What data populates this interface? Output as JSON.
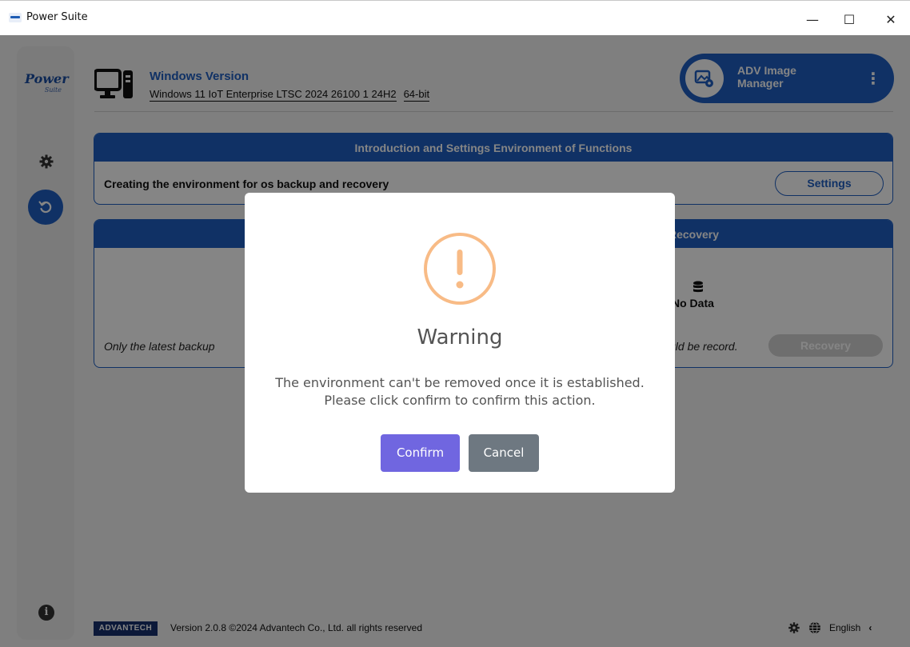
{
  "window": {
    "title": "Power Suite",
    "minimize": "—",
    "maximize": "☐",
    "close": "✕"
  },
  "sidebar": {
    "logo_main": "Power",
    "logo_sub": "Suite",
    "items": [
      {
        "icon": "gear-icon"
      },
      {
        "icon": "restore-icon",
        "active": true
      },
      {
        "icon": "info-icon"
      }
    ]
  },
  "header": {
    "os_title": "Windows Version",
    "os_name": "Windows 11 IoT Enterprise LTSC 2024 26100 1 24H2",
    "arch": "64-bit",
    "app_button": "ADV Image Manager"
  },
  "card_settings": {
    "title": "Introduction and Settings Environment of Functions",
    "description": "Creating the environment for os backup and recovery",
    "button": "Settings"
  },
  "card_recovery": {
    "title_visible": "Recovery",
    "no_data": "No Data",
    "note_left": "Only the latest backup",
    "note_right": "uld be record.",
    "button": "Recovery"
  },
  "footer": {
    "brand": "ADVANTECH",
    "version": "Version 2.0.8 ©2024 Advantech Co., Ltd. all rights reserved",
    "language": "English"
  },
  "dialog": {
    "title": "Warning",
    "message": "The environment can't be removed once it is established. Please click confirm to confirm this action.",
    "confirm": "Confirm",
    "cancel": "Cancel"
  },
  "colors": {
    "brand_blue": "#1f5fc2",
    "confirm": "#7066e0",
    "cancel": "#6e7881",
    "warning": "#f8bb86"
  }
}
